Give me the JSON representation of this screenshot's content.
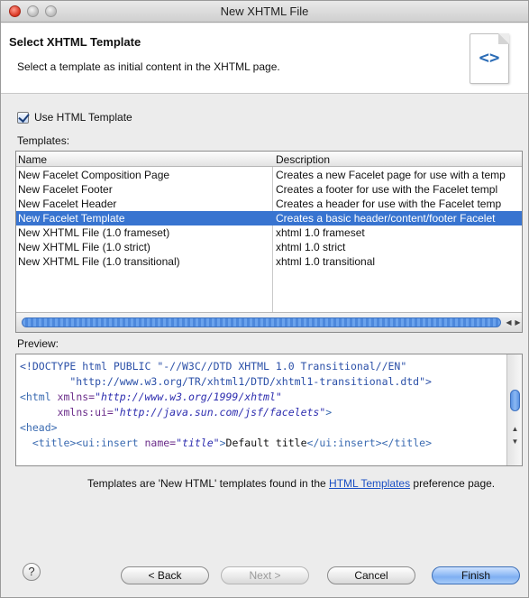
{
  "window": {
    "title": "New XHTML File"
  },
  "header": {
    "title": "Select XHTML Template",
    "description": "Select a template as initial content in the XHTML page.",
    "icon": "xhtml-template-icon",
    "icon_glyph": "<>"
  },
  "use_template": {
    "label": "Use HTML Template",
    "checked": true
  },
  "templates": {
    "label": "Templates:",
    "columns": [
      "Name",
      "Description"
    ],
    "rows": [
      {
        "name": "New Facelet Composition Page",
        "description": "Creates a new Facelet page for use with a temp"
      },
      {
        "name": "New Facelet Footer",
        "description": "Creates a footer for use with the Facelet templ"
      },
      {
        "name": "New Facelet Header",
        "description": "Creates a header for use with the Facelet temp"
      },
      {
        "name": "New Facelet Template",
        "description": "Creates a basic header/content/footer Facelet",
        "selected": true
      },
      {
        "name": "New XHTML File (1.0 frameset)",
        "description": "xhtml 1.0 frameset"
      },
      {
        "name": "New XHTML File (1.0 strict)",
        "description": "xhtml 1.0 strict"
      },
      {
        "name": "New XHTML File (1.0 transitional)",
        "description": "xhtml 1.0 transitional"
      }
    ]
  },
  "preview": {
    "label": "Preview:",
    "doctype_1": "<!DOCTYPE html PUBLIC \"-//W3C//DTD XHTML 1.0 Transitional//EN\"",
    "doctype_2": "        \"http://www.w3.org/TR/xhtml1/DTD/xhtml1-transitional.dtd\">",
    "html_open": "<html",
    "xmlns_attr": " xmlns=",
    "xmlns_val": "\"http://www.w3.org/1999/xhtml\"",
    "xmlns_ui_indent": "      ",
    "xmlns_ui_attr": "xmlns:ui=",
    "xmlns_ui_val": "\"http://java.sun.com/jsf/facelets\"",
    "xmlns_ui_close": ">",
    "head_open": "<head>",
    "title_open": "  <title><ui:insert",
    "title_attr": " name=",
    "title_val": "\"title\"",
    "title_close": ">",
    "title_text": "Default title",
    "title_end": "</ui:insert></title>"
  },
  "footnote": {
    "text_before": "Templates are 'New HTML' templates found in the ",
    "link": "HTML Templates",
    "text_after": " preference page."
  },
  "buttons": {
    "help": "?",
    "back": "< Back",
    "next": "Next >",
    "cancel": "Cancel",
    "finish": "Finish"
  },
  "colors": {
    "selection": "#3874d0",
    "link": "#1a4fc4",
    "finish_button": "#7fb0f2"
  }
}
